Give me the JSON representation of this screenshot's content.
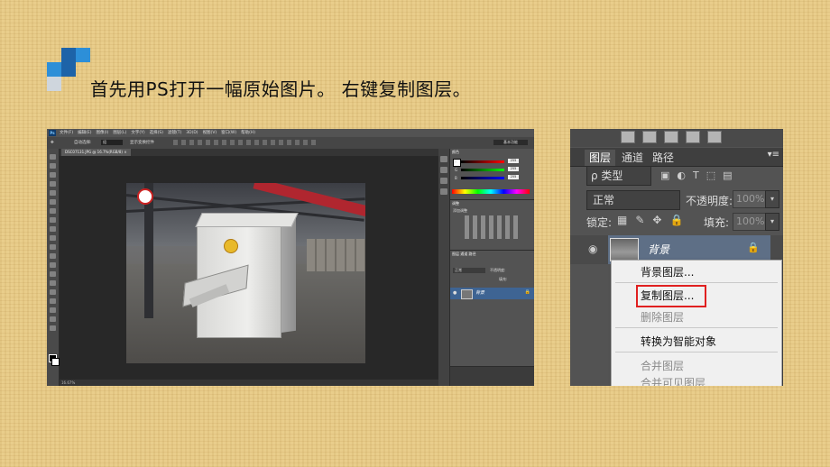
{
  "heading": "首先用PS打开一幅原始图片。 右键复制图层。",
  "colors": {
    "deco_dark": "#1d63a8",
    "deco_mid": "#2d8fd8",
    "deco_light": "#cfd6dd",
    "highlight": "#e02020"
  },
  "photoshop": {
    "logo": "Ps",
    "menus": [
      "文件(F)",
      "编辑(E)",
      "图像(I)",
      "图层(L)",
      "文字(Y)",
      "选择(S)",
      "滤镜(T)",
      "3D(D)",
      "视图(V)",
      "窗口(W)",
      "帮助(H)"
    ],
    "options_label": "自动选择:",
    "options_combo": "组",
    "options_checkbox": "显示变换控件",
    "workspace": "基本功能",
    "doc_tab": "DSC07131.JPG @ 16.7%(RGB/8) ×",
    "status": "16.67%",
    "color_panel": {
      "tab": "颜色",
      "r": "255",
      "g": "255",
      "b": "255"
    },
    "adjust_panel": {
      "tab": "调整",
      "add_label": "添加调整"
    },
    "layers_panel": {
      "tabs": "图层 通道 路径",
      "blend": "正常",
      "opacity_label": "不透明度:",
      "fill_label": "填充:",
      "layer_name": "背景"
    }
  },
  "layers_zoom": {
    "tabs": [
      "图层",
      "通道",
      "路径"
    ],
    "filter": "ρ 类型",
    "blend_mode": "正常",
    "opacity_label": "不透明度:",
    "opacity_value": "100%",
    "lock_label": "锁定:",
    "fill_label": "填充:",
    "fill_value": "100%",
    "layer_name": "背景",
    "context_menu": [
      {
        "label": "背景图层...",
        "enabled": true
      },
      {
        "label": "复制图层...",
        "enabled": true,
        "highlighted": true
      },
      {
        "label": "删除图层",
        "enabled": false
      },
      {
        "label": "转换为智能对象",
        "enabled": true
      },
      {
        "label": "合并图层",
        "enabled": false
      },
      {
        "label": "合并可见图层",
        "enabled": false
      }
    ]
  }
}
